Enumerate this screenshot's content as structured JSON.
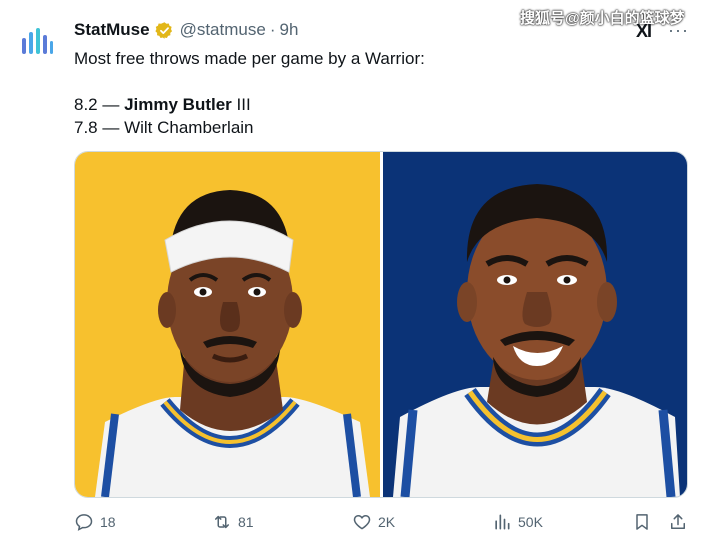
{
  "tweet": {
    "display_name": "StatMuse",
    "handle": "@statmuse",
    "separator": "·",
    "time": "9h",
    "line1": "Most free throws made per game by a Warrior:",
    "row1_value": "8.2 — ",
    "row1_bold": "Jimmy Butler",
    "row1_suffix": " III",
    "row2": "7.8 — Wilt Chamberlain"
  },
  "watermark": "搜狐号@颜小白的篮球梦",
  "grok_label": "XI",
  "more_label": "···",
  "media": {
    "left_panel_color": "#F7C12E",
    "right_panel_color": "#0B3377",
    "left_player": "Jimmy Butler illustration",
    "right_player": "Wilt Chamberlain illustration"
  },
  "actions": {
    "replies": "18",
    "reposts": "81",
    "likes": "2K",
    "views": "50K"
  },
  "icons": {
    "verified": "verified-badge-icon",
    "reply": "reply-icon",
    "repost": "repost-icon",
    "like": "heart-icon",
    "views": "views-icon",
    "bookmark": "bookmark-icon",
    "share": "share-icon"
  }
}
